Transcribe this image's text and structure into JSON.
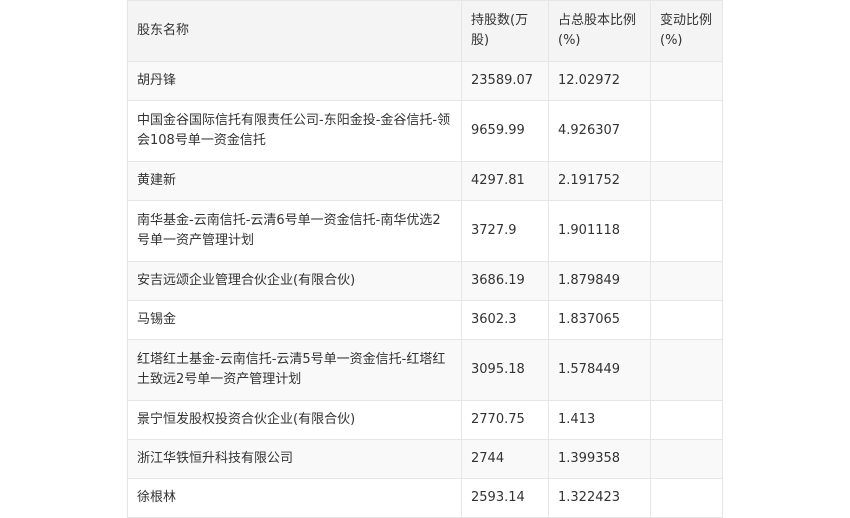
{
  "table": {
    "headers": {
      "name": "股东名称",
      "shares": "持股数(万股)",
      "ratio": "占总股本比例(%)",
      "change": "变动比例(%)"
    },
    "rows": [
      {
        "name": "胡丹锋",
        "shares": "23589.07",
        "ratio": "12.02972",
        "change": ""
      },
      {
        "name": "中国金谷国际信托有限责任公司-东阳金投-金谷信托-领会108号单一资金信托",
        "shares": "9659.99",
        "ratio": "4.926307",
        "change": ""
      },
      {
        "name": "黄建新",
        "shares": "4297.81",
        "ratio": "2.191752",
        "change": ""
      },
      {
        "name": "南华基金-云南信托-云清6号单一资金信托-南华优选2号单一资产管理计划",
        "shares": "3727.9",
        "ratio": "1.901118",
        "change": ""
      },
      {
        "name": "安吉远颂企业管理合伙企业(有限合伙)",
        "shares": "3686.19",
        "ratio": "1.879849",
        "change": ""
      },
      {
        "name": "马锡金",
        "shares": "3602.3",
        "ratio": "1.837065",
        "change": ""
      },
      {
        "name": "红塔红土基金-云南信托-云清5号单一资金信托-红塔红土致远2号单一资产管理计划",
        "shares": "3095.18",
        "ratio": "1.578449",
        "change": ""
      },
      {
        "name": "景宁恒发股权投资合伙企业(有限合伙)",
        "shares": "2770.75",
        "ratio": "1.413",
        "change": ""
      },
      {
        "name": "浙江华铁恒升科技有限公司",
        "shares": "2744",
        "ratio": "1.399358",
        "change": ""
      },
      {
        "name": "徐根林",
        "shares": "2593.14",
        "ratio": "1.322423",
        "change": ""
      }
    ]
  }
}
